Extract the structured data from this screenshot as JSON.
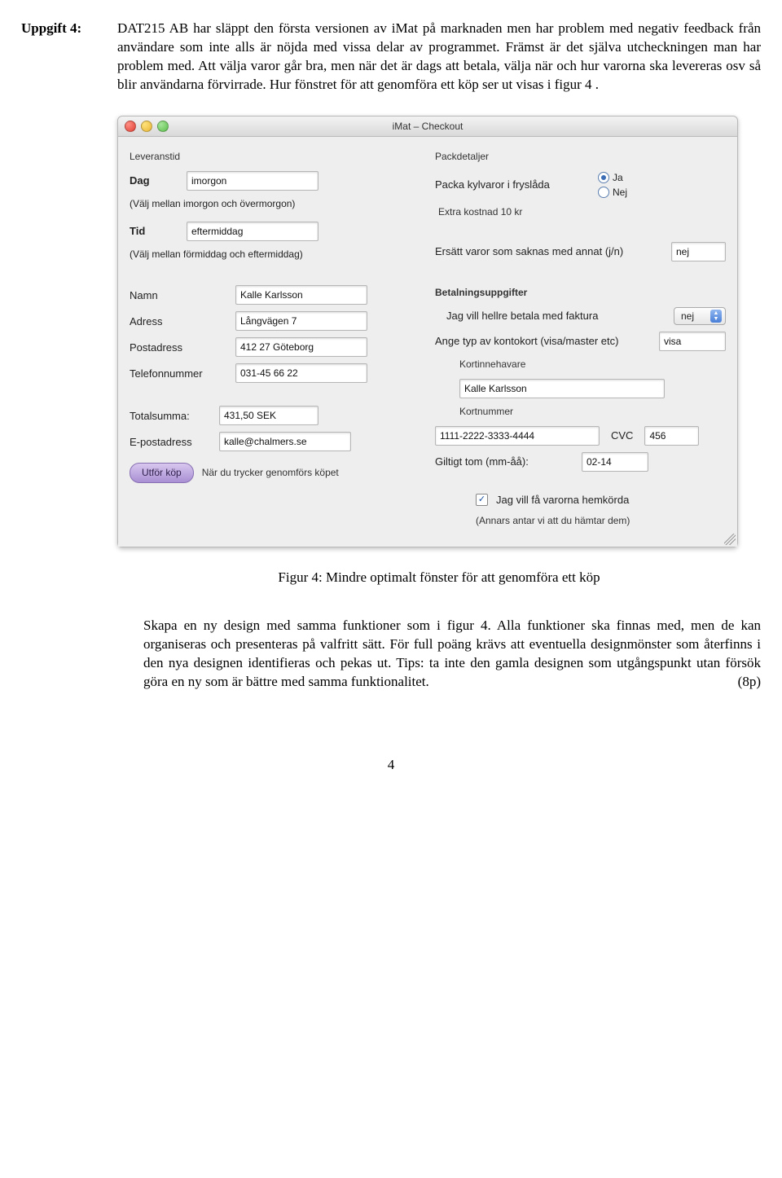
{
  "task": {
    "label": "Uppgift 4:",
    "para1": "DAT215 AB har släppt den första versionen av iMat på marknaden men har problem med negativ feedback från användare som inte alls är nöjda med vissa delar av programmet. Främst är det själva utcheckningen man har problem med. Att välja varor går bra, men när det är dags att betala, välja när och hur varorna ska levereras osv så blir användarna förvirrade. Hur fönstret för att genomföra ett köp ser ut visas i figur 4 ."
  },
  "window": {
    "title": "iMat – Checkout",
    "left": {
      "leveranstid": "Leveranstid",
      "dag_label": "Dag",
      "dag_value": "imorgon",
      "dag_hint": "(Välj mellan imorgon och övermorgon)",
      "tid_label": "Tid",
      "tid_value": "eftermiddag",
      "tid_hint": "(Välj mellan förmiddag och eftermiddag)",
      "namn_label": "Namn",
      "namn_value": "Kalle Karlsson",
      "adress_label": "Adress",
      "adress_value": "Långvägen 7",
      "postadress_label": "Postadress",
      "postadress_value": "412 27 Göteborg",
      "telefon_label": "Telefonnummer",
      "telefon_value": "031-45 66 22",
      "total_label": "Totalsumma:",
      "total_value": "431,50 SEK",
      "email_label": "E-postadress",
      "email_value": "kalle@chalmers.se",
      "submit": "Utför köp",
      "submit_note": "När du trycker genomförs köpet"
    },
    "right": {
      "packdetaljer": "Packdetaljer",
      "fryslada_label": "Packa kylvaror i fryslåda",
      "ja": "Ja",
      "nej": "Nej",
      "extra_kostnad": "Extra kostnad 10 kr",
      "ersatt_label": "Ersätt varor som saknas med annat (j/n)",
      "ersatt_value": "nej",
      "betalning_heading": "Betalningsuppgifter",
      "faktura_label": "Jag vill hellre betala med faktura",
      "faktura_value": "nej",
      "korttyp_label": "Ange typ av kontokort (visa/master etc)",
      "korttyp_value": "visa",
      "kortinnehavare_label": "Kortinnehavare",
      "kortinnehavare_value": "Kalle Karlsson",
      "kortnummer_label": "Kortnummer",
      "kortnummer_value": "1111-2222-3333-4444",
      "cvc_label": "CVC",
      "cvc_value": "456",
      "giltig_label": "Giltigt tom (mm-åå):",
      "giltig_value": "02-14",
      "hemkorda": "Jag vill få varorna hemkörda",
      "hemkorda_note": "(Annars antar vi att du hämtar dem)"
    }
  },
  "caption": "Figur 4: Mindre optimalt fönster för att genomföra ett köp",
  "after": "Skapa en ny design med samma funktioner som i figur 4. Alla funktioner ska finnas med, men de kan organiseras och presenteras på valfritt sätt. För full poäng krävs att eventuella designmönster som återfinns i den nya designen identifieras och pekas ut. Tips: ta inte den gamla designen som utgångspunkt utan försök göra en ny som är bättre med samma funktionalitet.",
  "points": "(8p)",
  "pagenum": "4"
}
